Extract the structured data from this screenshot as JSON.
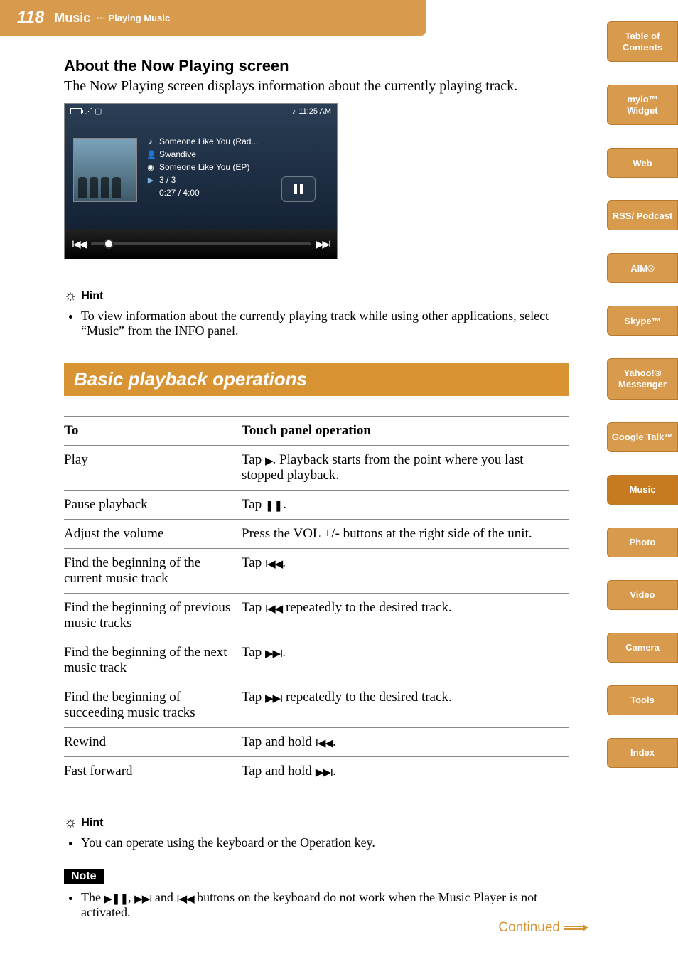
{
  "header": {
    "page_number": "118",
    "section": "Music",
    "subsection": "Playing Music"
  },
  "sidebar": [
    "Table of Contents",
    "mylo™ Widget",
    "Web",
    "RSS/ Podcast",
    "AIM®",
    "Skype™",
    "Yahoo!® Messenger",
    "Google Talk™",
    "Music",
    "Photo",
    "Video",
    "Camera",
    "Tools",
    "Index"
  ],
  "about": {
    "heading": "About the Now Playing screen",
    "intro": "The Now Playing screen displays information about the currently playing track."
  },
  "nowplaying": {
    "time": "11:25 AM",
    "title": "Someone Like You (Rad...",
    "artist": "Swandive",
    "album": "Someone Like You (EP)",
    "track_pos": "3 / 3",
    "elapsed": "0:27 / 4:00"
  },
  "hint1": {
    "label": "Hint",
    "items": [
      "To view information about the currently playing track while using other applications, select “Music” from the INFO panel."
    ]
  },
  "section_title": "Basic playback operations",
  "table": {
    "headers": [
      "To",
      "Touch panel operation"
    ],
    "rows": [
      {
        "to": "Play",
        "op_pre": "Tap ",
        "icon": "play",
        "op_post": ". Playback starts from the point where you last stopped playback."
      },
      {
        "to": "Pause playback",
        "op_pre": "Tap ",
        "icon": "pause",
        "op_post": "."
      },
      {
        "to": "Adjust the volume",
        "op_pre": "Press the VOL +/- buttons at the right side of the unit.",
        "icon": "",
        "op_post": ""
      },
      {
        "to": "Find the beginning of the current music track",
        "op_pre": "Tap ",
        "icon": "prev",
        "op_post": "."
      },
      {
        "to": "Find the beginning of previous music tracks",
        "op_pre": "Tap ",
        "icon": "prevbold",
        "op_post": " repeatedly to the desired track."
      },
      {
        "to": "Find the beginning of the next music track",
        "op_pre": "Tap ",
        "icon": "next",
        "op_post": "."
      },
      {
        "to": "Find the beginning of succeeding music tracks",
        "op_pre": "Tap ",
        "icon": "next",
        "op_post": " repeatedly to the desired track."
      },
      {
        "to": "Rewind",
        "op_pre": "Tap and hold ",
        "icon": "prevbold",
        "op_post": "."
      },
      {
        "to": "Fast forward",
        "op_pre": "Tap and hold ",
        "icon": "next",
        "op_post": "."
      }
    ]
  },
  "hint2": {
    "label": "Hint",
    "items": [
      "You can operate using the keyboard or the Operation key."
    ]
  },
  "note": {
    "label": "Note",
    "text_pre": "The ",
    "text_post": " buttons on the keyboard do not work when the Music Player is not activated."
  },
  "continued": "Continued",
  "icons": {
    "play": "▶",
    "pause": "❚❚",
    "prev": "I◀◀",
    "prevbold": "I◀◀",
    "next": "▶▶I",
    "playpause": "▶❚❚"
  }
}
